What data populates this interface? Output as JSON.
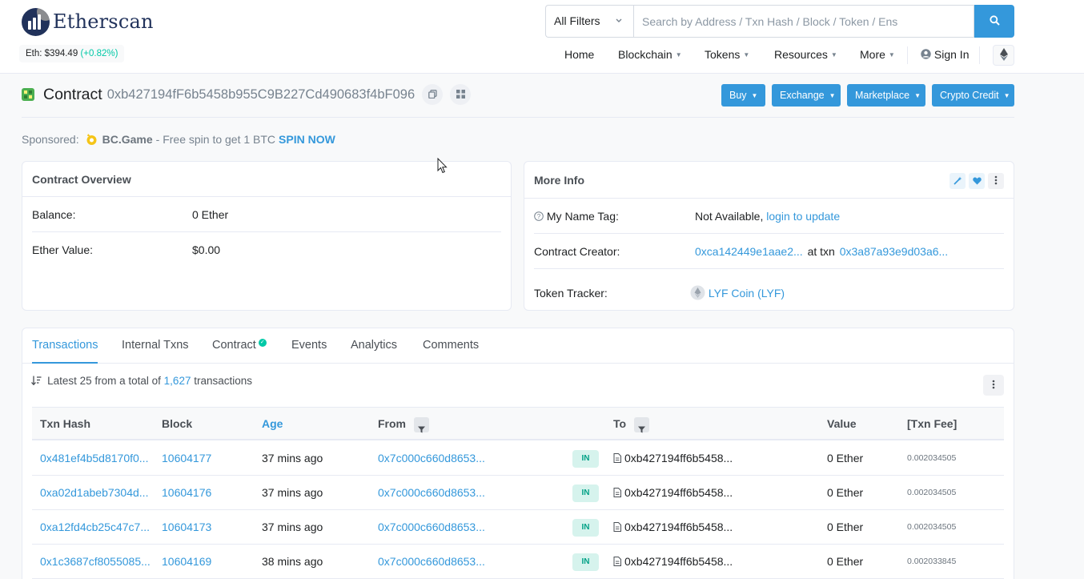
{
  "brand": {
    "name": "Etherscan",
    "eth_label": "Eth: $394.49",
    "eth_change": "(+0.82%)"
  },
  "search": {
    "filter_label": "All Filters",
    "placeholder": "Search by Address / Txn Hash / Block / Token / Ens"
  },
  "nav": {
    "items": [
      "Home",
      "Blockchain",
      "Tokens",
      "Resources",
      "More"
    ],
    "sign_in": "Sign In"
  },
  "contract": {
    "label": "Contract",
    "address": "0xb427194fF6b5458b955C9B227Cd490683f4bF096"
  },
  "actions": [
    "Buy",
    "Exchange",
    "Marketplace",
    "Crypto Credit"
  ],
  "sponsored": {
    "label": "Sponsored:",
    "brand": "BC.Game",
    "text": "- Free spin to get 1 BTC",
    "cta": "SPIN NOW"
  },
  "overview": {
    "title": "Contract Overview",
    "balance_label": "Balance:",
    "balance_value": "0 Ether",
    "ether_value_label": "Ether Value:",
    "ether_value_value": "$0.00"
  },
  "more_info": {
    "title": "More Info",
    "name_tag_label": "My Name Tag:",
    "name_tag_value": "Not Available,",
    "name_tag_link": "login to update",
    "creator_label": "Contract Creator:",
    "creator_address": "0xca142449e1aae2...",
    "creator_at_txn": "at txn",
    "creator_txn": "0x3a87a93e9d03a6...",
    "tracker_label": "Token Tracker:",
    "tracker_value": "LYF Coin (LYF)"
  },
  "tabs": [
    "Transactions",
    "Internal Txns",
    "Contract",
    "Events",
    "Analytics",
    "Comments"
  ],
  "txn_summary": {
    "prefix": "Latest 25 from a total of",
    "count": "1,627",
    "suffix": "transactions"
  },
  "table": {
    "headers": [
      "Txn Hash",
      "Block",
      "Age",
      "From",
      "To",
      "Value",
      "[Txn Fee]"
    ],
    "rows": [
      {
        "hash": "0x481ef4b5d8170f0...",
        "block": "10604177",
        "age": "37 mins ago",
        "from": "0x7c000c660d8653...",
        "dir": "IN",
        "to": "0xb427194ff6b5458...",
        "value": "0 Ether",
        "fee": "0.002034505"
      },
      {
        "hash": "0xa02d1abeb7304d...",
        "block": "10604176",
        "age": "37 mins ago",
        "from": "0x7c000c660d8653...",
        "dir": "IN",
        "to": "0xb427194ff6b5458...",
        "value": "0 Ether",
        "fee": "0.002034505"
      },
      {
        "hash": "0xa12fd4cb25c47c7...",
        "block": "10604173",
        "age": "37 mins ago",
        "from": "0x7c000c660d8653...",
        "dir": "IN",
        "to": "0xb427194ff6b5458...",
        "value": "0 Ether",
        "fee": "0.002034505"
      },
      {
        "hash": "0x1c3687cf8055085...",
        "block": "10604169",
        "age": "38 mins ago",
        "from": "0x7c000c660d8653...",
        "dir": "IN",
        "to": "0xb427194ff6b5458...",
        "value": "0 Ether",
        "fee": "0.002033845"
      }
    ]
  },
  "colors": {
    "accent": "#3498db",
    "brand_navy": "#21325b",
    "positive": "#00c9a7"
  }
}
